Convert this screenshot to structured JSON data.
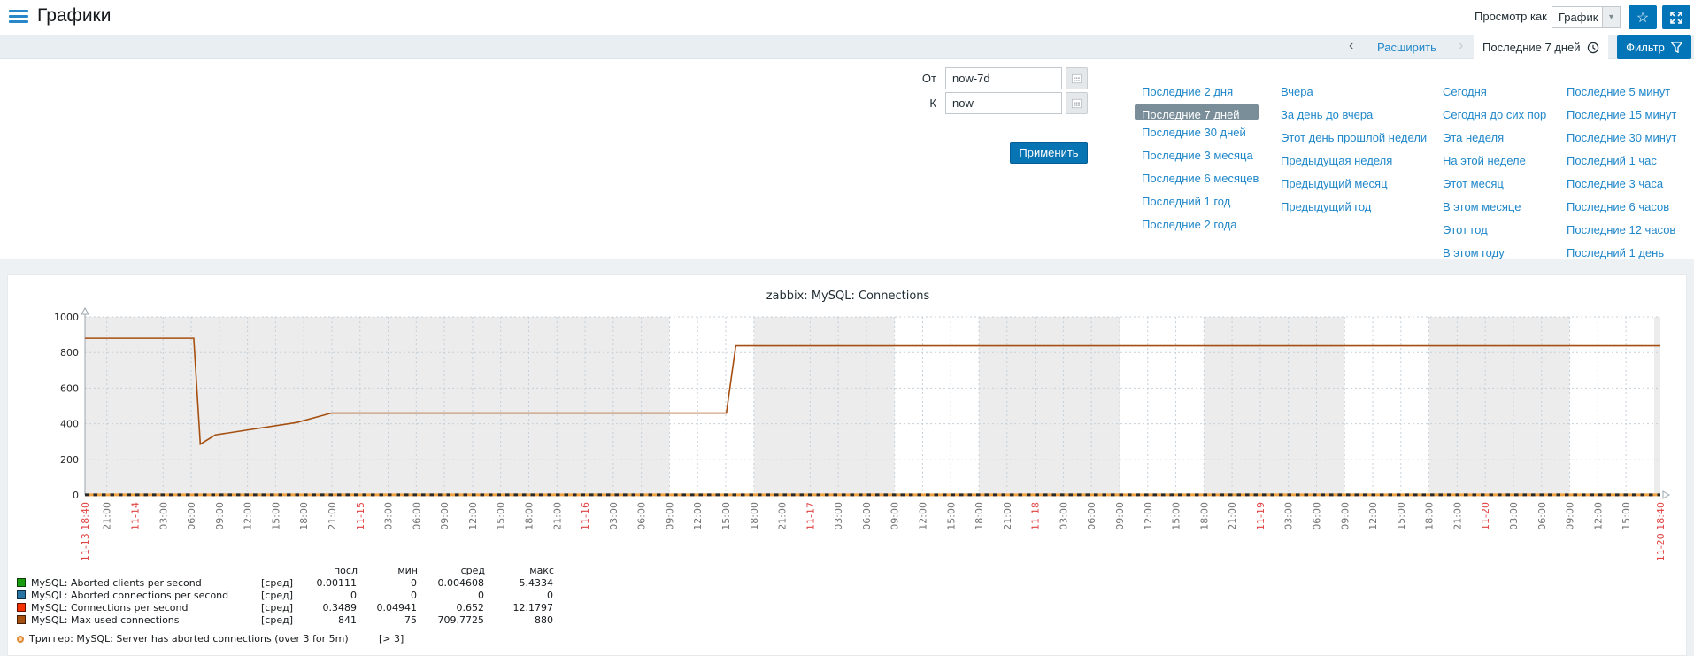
{
  "header": {
    "title": "Графики",
    "view_as_label": "Просмотр как",
    "view_as_value": "График"
  },
  "filter_bar": {
    "zoom_out_label": "Расширить",
    "prev_arrow": "‹",
    "next_arrow": "›",
    "active_range_label": "Последние 7 дней",
    "filter_button_label": "Фильтр"
  },
  "time_panel": {
    "from_label": "От",
    "from_value": "now-7d",
    "to_label": "К",
    "to_value": "now",
    "apply_label": "Применить",
    "selected_range": "Последние 7 дней",
    "quick_ranges": {
      "col1": [
        "Последние 2 дня",
        "Последние 7 дней",
        "Последние 30 дней",
        "Последние 3 месяца",
        "Последние 6 месяцев",
        "Последний 1 год",
        "Последние 2 года"
      ],
      "col2": [
        "Вчера",
        "За день до вчера",
        "Этот день прошлой недели",
        "Предыдущая неделя",
        "Предыдущий месяц",
        "Предыдущий год"
      ],
      "col3": [
        "Сегодня",
        "Сегодня до сих пор",
        "Эта неделя",
        "На этой неделе",
        "Этот месяц",
        "В этом месяце",
        "Этот год",
        "В этом году"
      ],
      "col4": [
        "Последние 5 минут",
        "Последние 15 минут",
        "Последние 30 минут",
        "Последний 1 час",
        "Последние 3 часа",
        "Последние 6 часов",
        "Последние 12 часов",
        "Последний 1 день"
      ]
    }
  },
  "chart_data": {
    "type": "line",
    "title": "zabbix: MySQL: Connections",
    "ylim": [
      0,
      1000
    ],
    "yticks": [
      0,
      200,
      400,
      600,
      800,
      1000
    ],
    "x_hours_total": 168,
    "x_range_label": "11-13 18:40 — 11-20 18:40",
    "grid": true,
    "xticks": [
      [
        0,
        "11-13 18:40",
        1
      ],
      [
        2.33,
        "21:00",
        0
      ],
      [
        5.33,
        "11-14",
        1
      ],
      [
        8.33,
        "03:00",
        0
      ],
      [
        11.33,
        "06:00",
        0
      ],
      [
        14.33,
        "09:00",
        0
      ],
      [
        17.33,
        "12:00",
        0
      ],
      [
        20.33,
        "15:00",
        0
      ],
      [
        23.33,
        "18:00",
        0
      ],
      [
        26.33,
        "21:00",
        0
      ],
      [
        29.33,
        "11-15",
        1
      ],
      [
        32.33,
        "03:00",
        0
      ],
      [
        35.33,
        "06:00",
        0
      ],
      [
        38.33,
        "09:00",
        0
      ],
      [
        41.33,
        "12:00",
        0
      ],
      [
        44.33,
        "15:00",
        0
      ],
      [
        47.33,
        "18:00",
        0
      ],
      [
        50.33,
        "21:00",
        0
      ],
      [
        53.33,
        "11-16",
        1
      ],
      [
        56.33,
        "03:00",
        0
      ],
      [
        59.33,
        "06:00",
        0
      ],
      [
        62.33,
        "09:00",
        0
      ],
      [
        65.33,
        "12:00",
        0
      ],
      [
        68.33,
        "15:00",
        0
      ],
      [
        71.33,
        "18:00",
        0
      ],
      [
        74.33,
        "21:00",
        0
      ],
      [
        77.33,
        "11-17",
        1
      ],
      [
        80.33,
        "03:00",
        0
      ],
      [
        83.33,
        "06:00",
        0
      ],
      [
        86.33,
        "09:00",
        0
      ],
      [
        89.33,
        "12:00",
        0
      ],
      [
        92.33,
        "15:00",
        0
      ],
      [
        95.33,
        "18:00",
        0
      ],
      [
        98.33,
        "21:00",
        0
      ],
      [
        101.33,
        "11-18",
        1
      ],
      [
        104.33,
        "03:00",
        0
      ],
      [
        107.33,
        "06:00",
        0
      ],
      [
        110.33,
        "09:00",
        0
      ],
      [
        113.33,
        "12:00",
        0
      ],
      [
        116.33,
        "15:00",
        0
      ],
      [
        119.33,
        "18:00",
        0
      ],
      [
        122.33,
        "21:00",
        0
      ],
      [
        125.33,
        "11-19",
        1
      ],
      [
        128.33,
        "03:00",
        0
      ],
      [
        131.33,
        "06:00",
        0
      ],
      [
        134.33,
        "09:00",
        0
      ],
      [
        137.33,
        "12:00",
        0
      ],
      [
        140.33,
        "15:00",
        0
      ],
      [
        143.33,
        "18:00",
        0
      ],
      [
        146.33,
        "21:00",
        0
      ],
      [
        149.33,
        "11-20",
        1
      ],
      [
        152.33,
        "03:00",
        0
      ],
      [
        155.33,
        "06:00",
        0
      ],
      [
        158.33,
        "09:00",
        0
      ],
      [
        161.33,
        "12:00",
        0
      ],
      [
        164.33,
        "15:00",
        0
      ],
      [
        168,
        "11-20 18:40",
        1
      ]
    ],
    "working_bands_hours": [
      [
        62.33,
        71.33
      ],
      [
        86.33,
        95.33
      ],
      [
        110.33,
        119.33
      ],
      [
        134.33,
        143.33
      ],
      [
        158.33,
        167.33
      ]
    ],
    "series": [
      {
        "name": "MySQL: Max used connections",
        "color": "#A54F10",
        "points": [
          [
            0,
            880
          ],
          [
            11.6,
            880
          ],
          [
            12.3,
            285
          ],
          [
            13.9,
            337
          ],
          [
            22.6,
            407
          ],
          [
            26.3,
            460
          ],
          [
            68.4,
            460
          ],
          [
            69.4,
            838
          ],
          [
            168,
            838
          ]
        ]
      },
      {
        "name": "MySQL: Connections per second",
        "color": "#F63100",
        "points": [
          [
            0,
            2
          ],
          [
            168,
            2
          ]
        ]
      }
    ],
    "trigger": {
      "value": 3,
      "color": "#EFA23F"
    },
    "colors": {
      "nonworking_bg": "#ececec",
      "working_bg": "#ffffff",
      "gridline": "#c6d0d8",
      "axis": "#9aa6ad",
      "tick_time": "#737373",
      "tick_date": "#e04343"
    },
    "legend": {
      "headers": {
        "last": "посл",
        "min": "мин",
        "avg": "сред",
        "max": "макс"
      },
      "rows": [
        {
          "color": "#199C0D",
          "name": "MySQL: Aborted clients per second",
          "func": "[сред]",
          "last": "0.00111",
          "min": "0",
          "avg": "0.004608",
          "max": "5.4334"
        },
        {
          "color": "#2774A4",
          "name": "MySQL: Aborted connections per second",
          "func": "[сред]",
          "last": "0",
          "min": "0",
          "avg": "0",
          "max": "0"
        },
        {
          "color": "#F63100",
          "name": "MySQL: Connections per second",
          "func": "[сред]",
          "last": "0.3489",
          "min": "0.04941",
          "avg": "0.652",
          "max": "12.1797"
        },
        {
          "color": "#A54F10",
          "name": "MySQL: Max used connections",
          "func": "[сред]",
          "last": "841",
          "min": "75",
          "avg": "709.7725",
          "max": "880"
        }
      ],
      "trigger_row": {
        "name": "Триггер: MySQL: Server has aborted connections (over 3 for 5m)",
        "threshold": "[> 3]"
      }
    }
  }
}
